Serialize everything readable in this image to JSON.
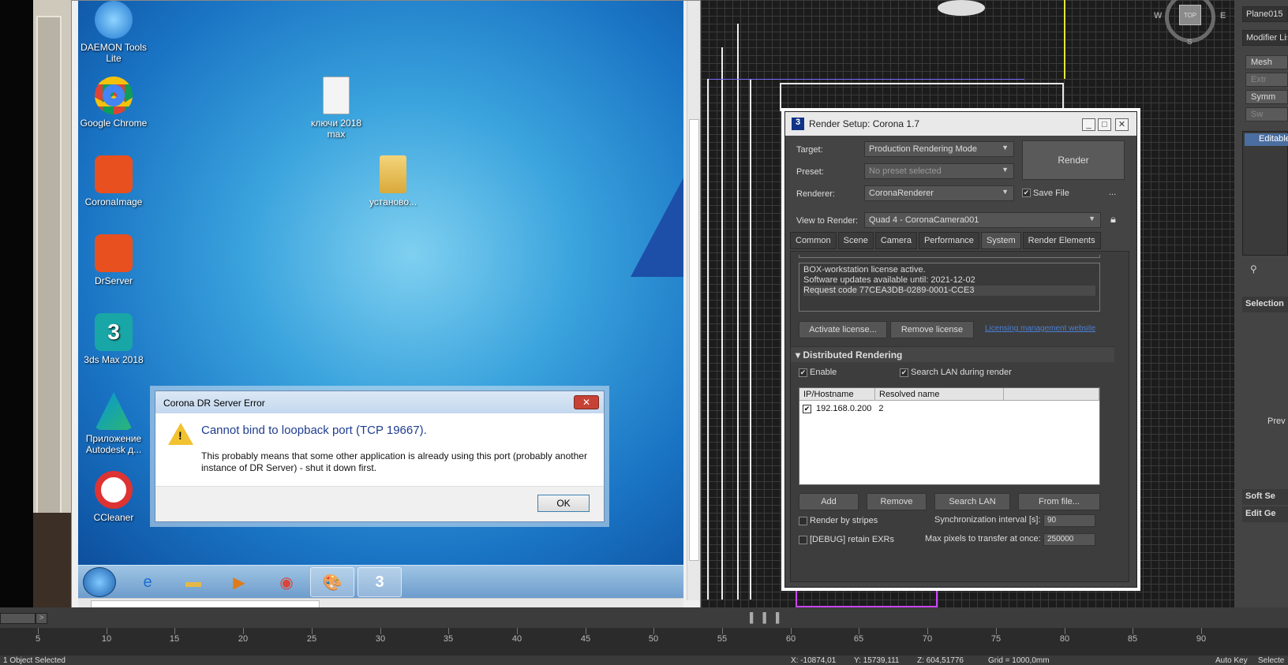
{
  "desktop": {
    "icons": [
      {
        "label": "DAEMON Tools Lite",
        "icon": "daemon-tools-icon"
      },
      {
        "label": "Google Chrome",
        "icon": "chrome-icon"
      },
      {
        "label": "CoronaImage",
        "icon": "corona-image-icon"
      },
      {
        "label": "DrServer",
        "icon": "drserver-icon"
      },
      {
        "label": "3ds Max 2018",
        "icon": "3dsmax-icon"
      },
      {
        "label": "Приложение Autodesk д...",
        "icon": "autodesk-app-icon"
      },
      {
        "label": "CCleaner",
        "icon": "ccleaner-icon"
      },
      {
        "label": "ключи 2018 max",
        "icon": "text-file-icon"
      },
      {
        "label": "установо...",
        "icon": "folder-icon"
      }
    ],
    "taskbar": [
      "start-orb",
      "internet-explorer",
      "file-explorer",
      "media-player",
      "chrome",
      "paint",
      "3ds-max"
    ]
  },
  "error_dialog": {
    "title": "Corona DR Server Error",
    "heading": "Cannot bind to loopback port (TCP 19667).",
    "message": "This probably means that some other application is already using this port (probably another instance of DR Server) - shut it down first.",
    "ok_label": "OK",
    "close_label": "✕"
  },
  "viewcube": {
    "w": "W",
    "e": "E",
    "s": "S",
    "face": "TOP"
  },
  "right_panel": {
    "object_name": "Plane015",
    "modifier_list": "Modifier List",
    "buttons": [
      "Mesh",
      "Extr",
      "Symm",
      "Sw"
    ],
    "stack_item": "Editable",
    "rollouts": [
      "Selection",
      "Soft Se",
      "Edit Ge"
    ],
    "preview": "Prev"
  },
  "render_setup": {
    "title": "Render Setup: Corona 1.7",
    "target_label": "Target:",
    "target_value": "Production Rendering Mode",
    "preset_label": "Preset:",
    "preset_value": "No preset selected",
    "renderer_label": "Renderer:",
    "renderer_value": "CoronaRenderer",
    "save_file_label": "Save File",
    "more_label": "...",
    "view_label": "View to Render:",
    "view_value": "Quad 4 - CoronaCamera001",
    "render_button": "Render",
    "tabs": [
      "Common",
      "Scene",
      "Camera",
      "Performance",
      "System",
      "Render Elements"
    ],
    "active_tab": "System",
    "license_lines": [
      "BOX-workstation license active.",
      "Software updates available until: 2021-12-02",
      "Request code 77CEA3DB-0289-0001-CCE3"
    ],
    "activate_license": "Activate license...",
    "remove_license": "Remove license",
    "licensing_link": "Licensing management website",
    "dr_section": "Distributed Rendering",
    "enable_label": "Enable",
    "search_lan_label": "Search LAN during render",
    "table_headers": [
      "IP/Hostname",
      "Resolved name"
    ],
    "table_rows": [
      {
        "ip": "192.168.0.200",
        "resolved": "2",
        "checked": true
      }
    ],
    "buttons": [
      "Add",
      "Remove",
      "Search LAN",
      "From file..."
    ],
    "render_by_stripes": "Render by stripes",
    "sync_label": "Synchronization interval [s]:",
    "sync_value": "90",
    "debug_label": "[DEBUG] retain EXRs",
    "max_pixels_label": "Max pixels to transfer at once:",
    "max_pixels_value": "250000"
  },
  "timeline": {
    "ticks": [
      "5",
      "10",
      "15",
      "20",
      "25",
      "30",
      "35",
      "40",
      "45",
      "50",
      "55",
      "60",
      "65",
      "70",
      "75",
      "80",
      "85",
      "90"
    ]
  },
  "status": {
    "selected": "1 Object Selected",
    "x": "X: -10874,01",
    "y": "Y: 15739,111",
    "z": "Z: 604,51776",
    "grid": "Grid = 1000,0mm",
    "auto_key": "Auto Key",
    "selected_btn": "Selecte"
  }
}
